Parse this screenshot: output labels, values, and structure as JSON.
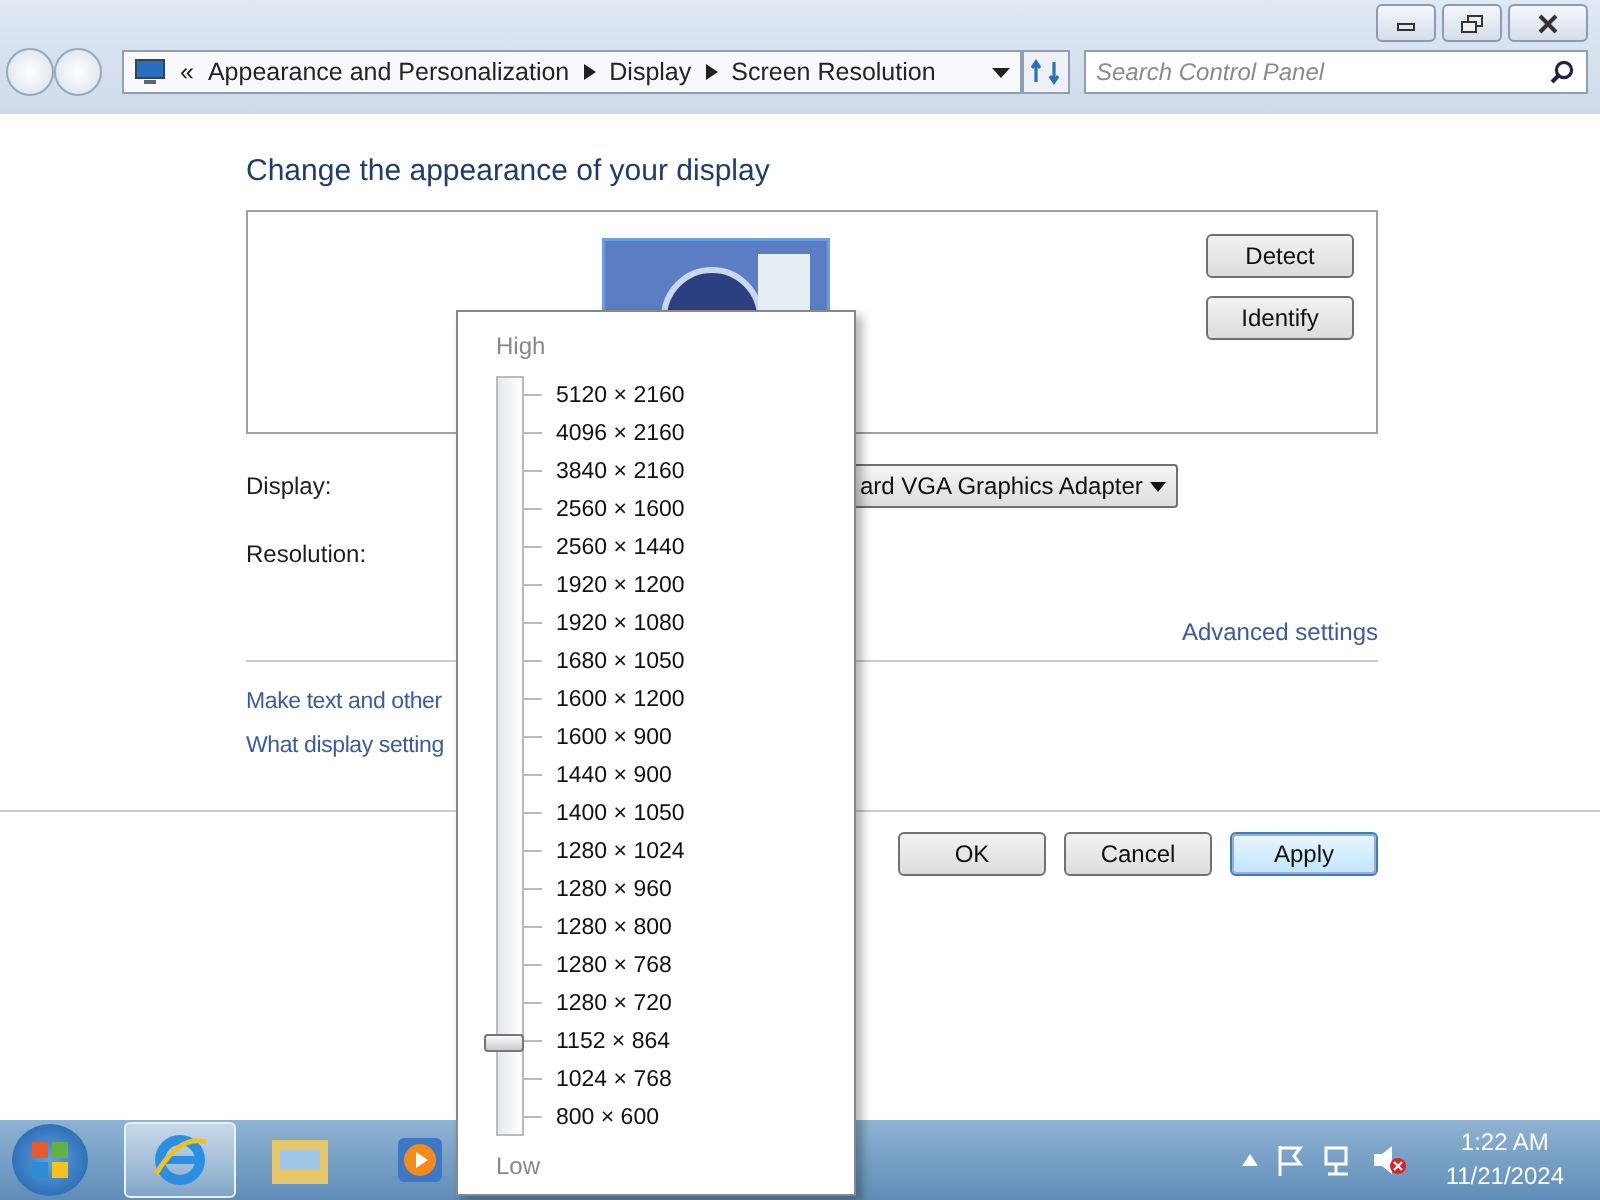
{
  "address_bar": {
    "overflow": "«",
    "breadcrumbs": [
      "Appearance and Personalization",
      "Display",
      "Screen Resolution"
    ]
  },
  "search": {
    "placeholder": "Search Control Panel"
  },
  "heading": "Change the appearance of your display",
  "preview_buttons": [
    "Detect",
    "Identify"
  ],
  "display": {
    "label": "Display:",
    "value": "ard VGA Graphics Adapter"
  },
  "resolution": {
    "label": "Resolution:"
  },
  "advanced_link": "Advanced settings",
  "links": [
    "Make text and other",
    "What display setting"
  ],
  "dialog_buttons": [
    {
      "label": "OK",
      "default": false
    },
    {
      "label": "Cancel",
      "default": false
    },
    {
      "label": "Apply",
      "default": true
    }
  ],
  "resolution_popup": {
    "high_label": "High",
    "low_label": "Low",
    "level": 0.105,
    "options": [
      "5120 × 2160",
      "4096 × 2160",
      "3840 × 2160",
      "2560 × 1600",
      "2560 × 1440",
      "1920 × 1200",
      "1920 × 1080",
      "1680 × 1050",
      "1600 × 1200",
      "1600 × 900",
      "1440 × 900",
      "1400 × 1050",
      "1280 × 1024",
      "1280 × 960",
      "1280 × 800",
      "1280 × 768",
      "1280 × 720",
      "1152 × 864",
      "1024 × 768",
      "800 × 600"
    ]
  },
  "taskbar": {
    "pinned": [
      {
        "kind": "browser",
        "active": true
      },
      {
        "kind": "folder",
        "active": false
      },
      {
        "kind": "media",
        "active": false
      }
    ],
    "time": "1:22 AM",
    "date": "11/21/2024"
  }
}
